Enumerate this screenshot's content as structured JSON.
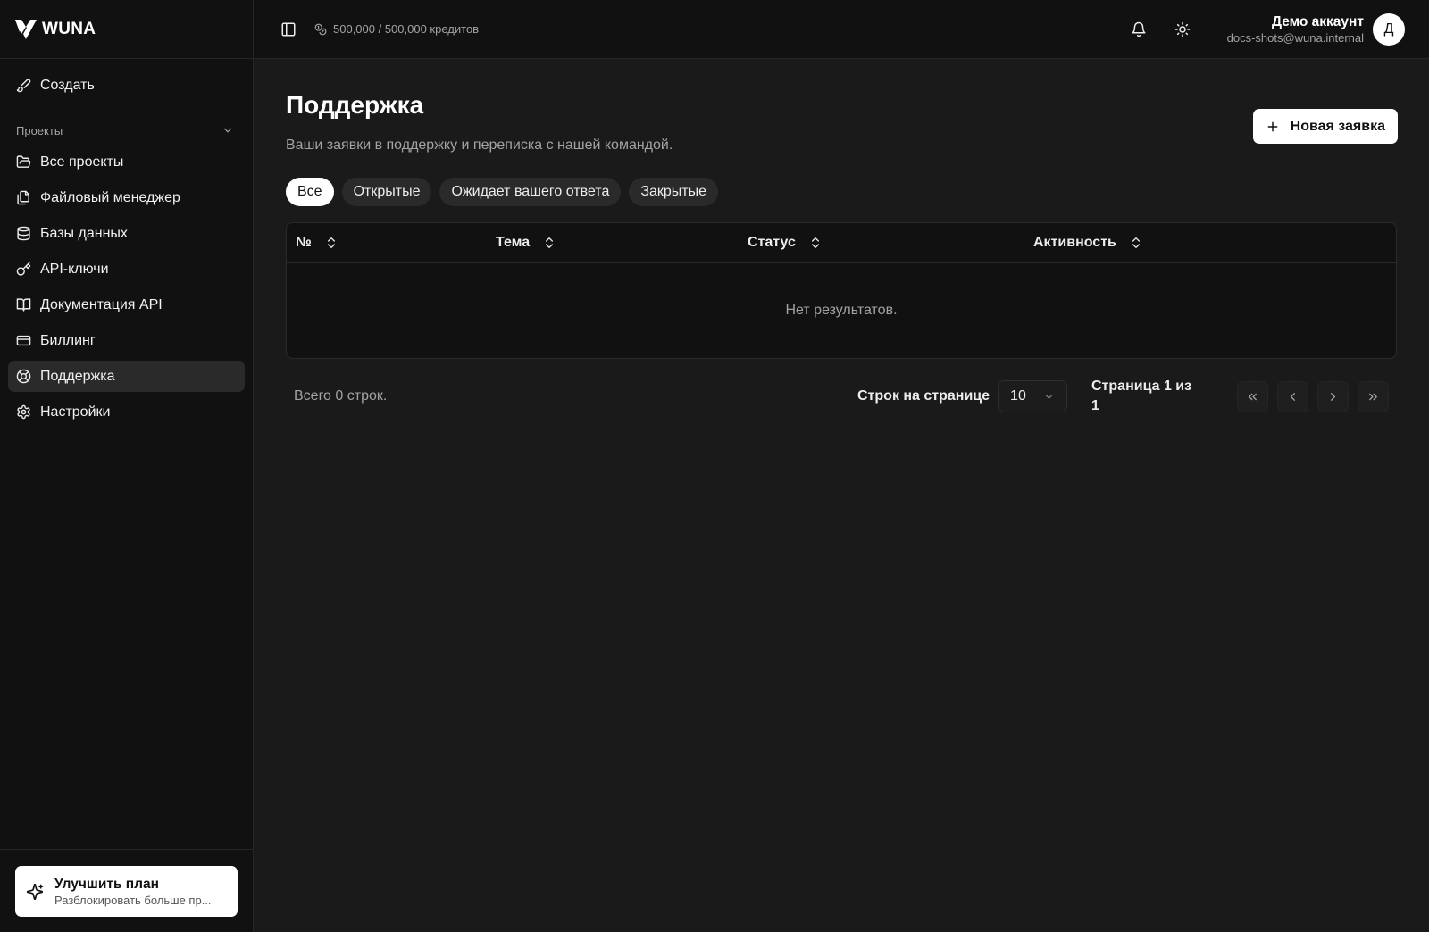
{
  "brand": {
    "name": "WUNA"
  },
  "sidebar": {
    "create_label": "Создать",
    "section_label": "Проекты",
    "items": [
      {
        "label": "Все проекты",
        "icon": "folder-open-icon"
      },
      {
        "label": "Файловый менеджер",
        "icon": "files-icon"
      },
      {
        "label": "Базы данных",
        "icon": "database-icon"
      },
      {
        "label": "API-ключи",
        "icon": "key-icon"
      },
      {
        "label": "Документация API",
        "icon": "book-open-icon"
      },
      {
        "label": "Биллинг",
        "icon": "credit-card-icon"
      },
      {
        "label": "Поддержка",
        "icon": "life-buoy-icon",
        "active": true
      },
      {
        "label": "Настройки",
        "icon": "gear-icon"
      }
    ],
    "upgrade": {
      "title": "Улучшить план",
      "subtitle": "Разблокировать больше пр..."
    }
  },
  "topbar": {
    "credits": "500,000 / 500,000 кредитов",
    "account_name": "Демо аккаунт",
    "account_email": "docs-shots@wuna.internal",
    "avatar_initial": "Д"
  },
  "page": {
    "title": "Поддержка",
    "description": "Ваши заявки в поддержку и переписка с нашей командой.",
    "new_ticket_label": "Новая заявка",
    "tabs": [
      {
        "label": "Все",
        "active": true
      },
      {
        "label": "Открытые"
      },
      {
        "label": "Ожидает вашего ответа"
      },
      {
        "label": "Закрытые"
      }
    ]
  },
  "table": {
    "columns": [
      "№",
      "Тема",
      "Статус",
      "Активность"
    ],
    "empty_text": "Нет результатов."
  },
  "pagination": {
    "total_text": "Всего 0 строк.",
    "rows_per_page_label": "Строк на странице",
    "rows_per_page_value": "10",
    "page_info": "Страница 1 из 1"
  },
  "colors": {
    "background": "#1a1a1a",
    "sidebar": "#111111",
    "accent": "#ffffff"
  }
}
